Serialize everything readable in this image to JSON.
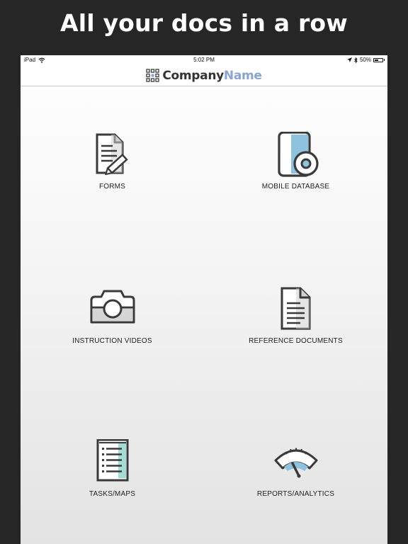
{
  "headline": "All your docs in a row",
  "status_bar": {
    "device": "iPad",
    "time": "5:02 PM",
    "battery": "50%",
    "battery_level": 0.5
  },
  "brand": {
    "part1": "Company",
    "part2": "Name"
  },
  "colors": {
    "accent_blue": "#8fc2dd",
    "accent_teal": "#a3dcd3",
    "brand_blue": "#8aa4cf",
    "icon_stroke": "#3a3a3a"
  },
  "tiles": [
    {
      "label": "FORMS",
      "icon": "document-pencil-icon"
    },
    {
      "label": "MOBILE DATABASE",
      "icon": "database-disc-icon"
    },
    {
      "label": "INSTRUCTION VIDEOS",
      "icon": "camera-icon"
    },
    {
      "label": "REFERENCE DOCUMENTS",
      "icon": "document-icon"
    },
    {
      "label": "TASKS/MAPS",
      "icon": "checklist-icon"
    },
    {
      "label": "REPORTS/ANALYTICS",
      "icon": "gauge-icon"
    }
  ]
}
